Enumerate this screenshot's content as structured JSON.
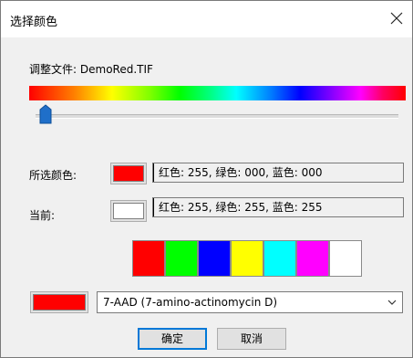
{
  "window": {
    "title": "选择颜色"
  },
  "file": {
    "label": "调整文件:",
    "name": "DemoRed.TIF"
  },
  "selected": {
    "label": "所选颜色:",
    "color": "#ff0000",
    "rgb_text": "红色: 255, 绿色: 000, 蓝色: 000"
  },
  "current": {
    "label": "当前:",
    "color": "#ffffff",
    "rgb_text": "红色: 255, 绿色: 255, 蓝色: 255"
  },
  "slider": {
    "value_fraction": 0.02
  },
  "palette": [
    "#ff0000",
    "#00ff00",
    "#0000ff",
    "#ffff00",
    "#00ffff",
    "#ff00ff",
    "#ffffff"
  ],
  "dye": {
    "color": "#ff0000",
    "selected": "7-AAD (7-amino-actinomycin D)"
  },
  "buttons": {
    "ok": "确定",
    "cancel": "取消"
  },
  "icons": {
    "close": "close-icon",
    "dropdown": "chevron-down-icon",
    "slider": "slider-thumb"
  }
}
